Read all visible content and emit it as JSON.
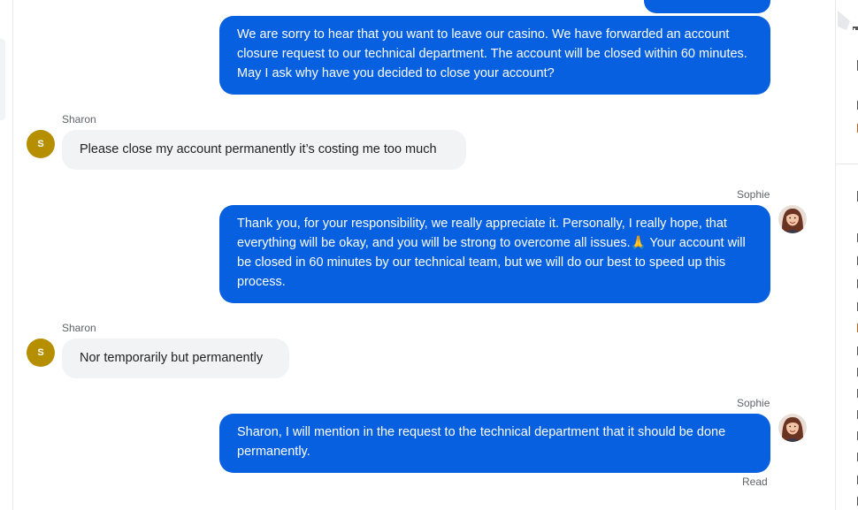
{
  "messages": [
    {
      "sender": "Sophie",
      "role": "agent",
      "text": "We are sorry to hear that you want to leave our casino. We have forwarded an account closure request to our technical department. The account will be closed within 60 minutes. May I ask why have you decided to close your account?"
    },
    {
      "sender": "Sharon",
      "role": "user",
      "avatar_initial": "S",
      "text": "Please close my account permanently it’s costing me too much"
    },
    {
      "sender": "Sophie",
      "role": "agent",
      "text": "Thank you, for your responsibility, we really appreciate it. Personally, I really hope, that everything will be okay, and you will be strong to overcome all issues.🙏 Your account will be closed in 60 minutes by our technical team, but we will do our best to speed up this process."
    },
    {
      "sender": "Sharon",
      "role": "user",
      "avatar_initial": "S",
      "text": "Nor temporarily but permanently"
    },
    {
      "sender": "Sophie",
      "role": "agent",
      "text": "Sharon, I will mention in the request to the technical department that it should be done permanently.",
      "status": "Read"
    }
  ],
  "colors": {
    "agent_bubble": "#0660e0",
    "user_bubble": "#f2f3f5",
    "user_avatar": "#b58f00"
  },
  "icons": {
    "agent_avatar": "sophie-avatar-photo",
    "user_avatar": "initial-avatar"
  }
}
